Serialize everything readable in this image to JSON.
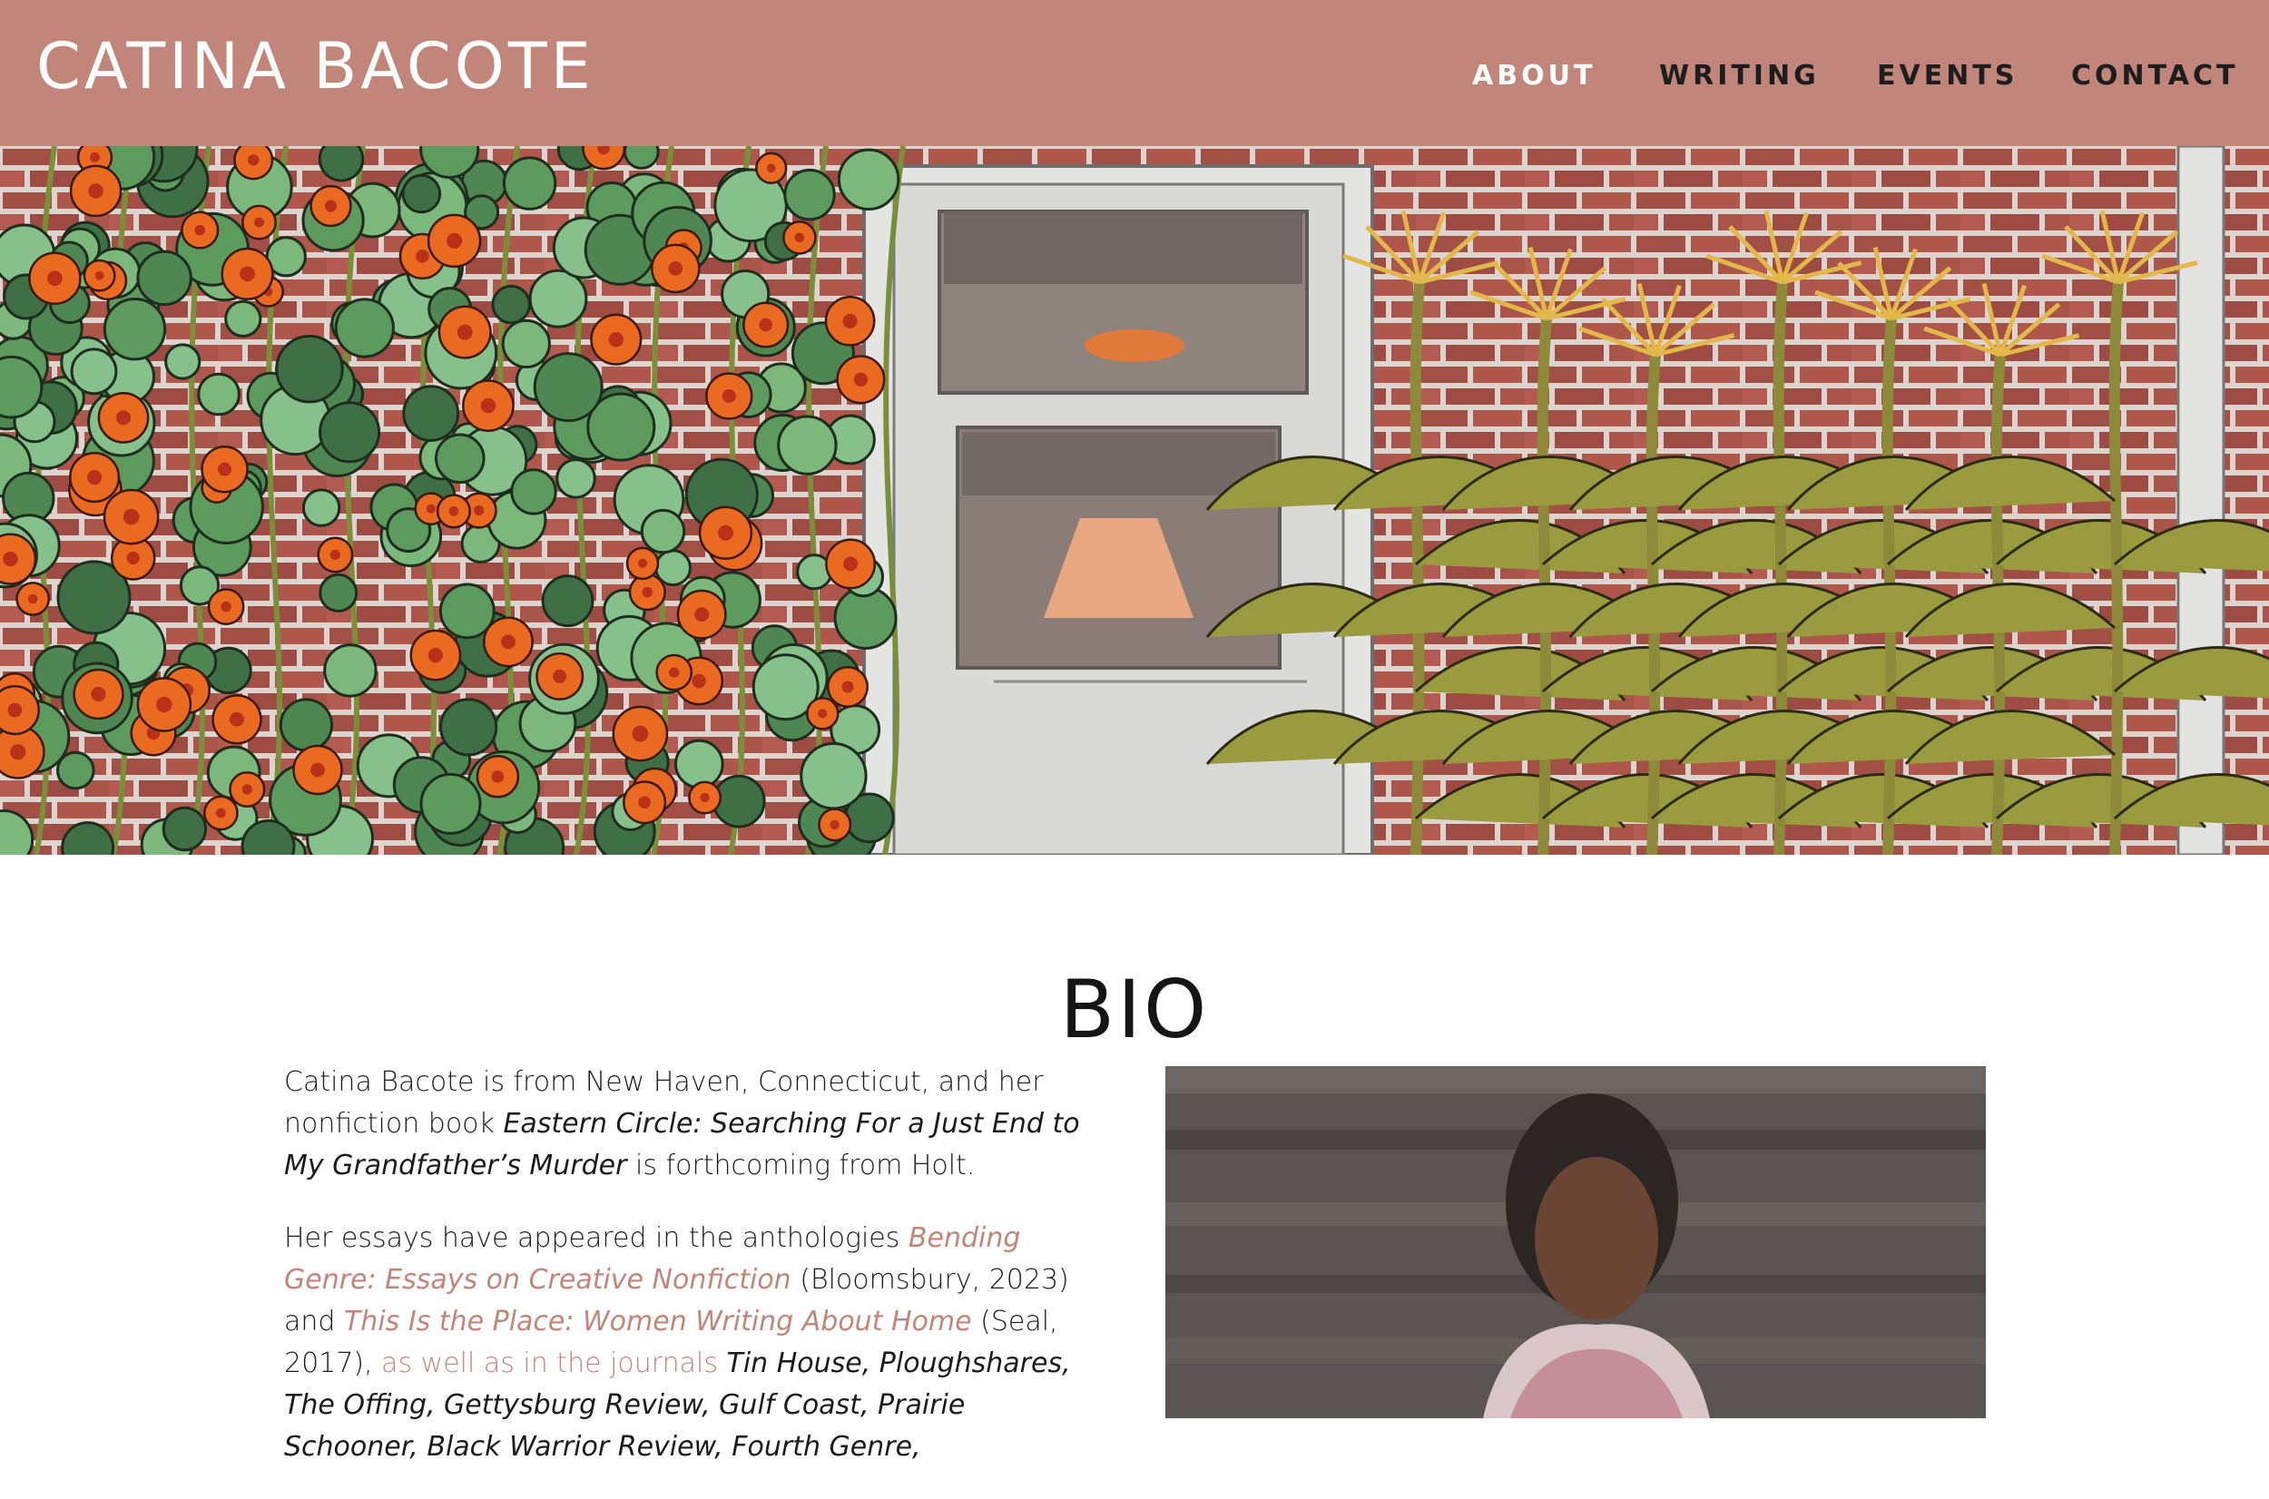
{
  "site": {
    "title": "CATINA BACOTE"
  },
  "nav": [
    {
      "label": "ABOUT",
      "active": true
    },
    {
      "label": "WRITING",
      "active": false
    },
    {
      "label": "EVENTS",
      "active": false
    },
    {
      "label": "CONTACT",
      "active": false
    }
  ],
  "hero": {
    "icons": [
      "brick-wall-illustration",
      "nasturtium-vines",
      "screen-door",
      "corn-stalks"
    ]
  },
  "bio": {
    "heading": "BIO",
    "p1": {
      "t1": "Catina Bacote is from New Haven, Connecticut, and her nonfiction book ",
      "book": "Eastern Circle: Searching For a Just End to My Grandfather’s Murder",
      "t2": " is forthcoming from Holt."
    },
    "p2": {
      "t1": "Her essays have appeared in the anthologies ",
      "link1": "Bending Genre: Essays on Creative Nonfiction",
      "t2": " (Bloomsbury, 2023) and ",
      "link2": "This Is the Place: Women Writing About Home",
      "t3": " (Seal, 2017), ",
      "link3": "as well as in the journals",
      "t4": " ",
      "journals": "Tin House, Ploughshares, The Offing, Gettysburg Review, Gulf Coast, Prairie Schooner, Black Warrior Review, Fourth Genre,"
    }
  },
  "colors": {
    "header": "#c2857a",
    "link": "#c2857a",
    "text": "#1b1b1b"
  }
}
